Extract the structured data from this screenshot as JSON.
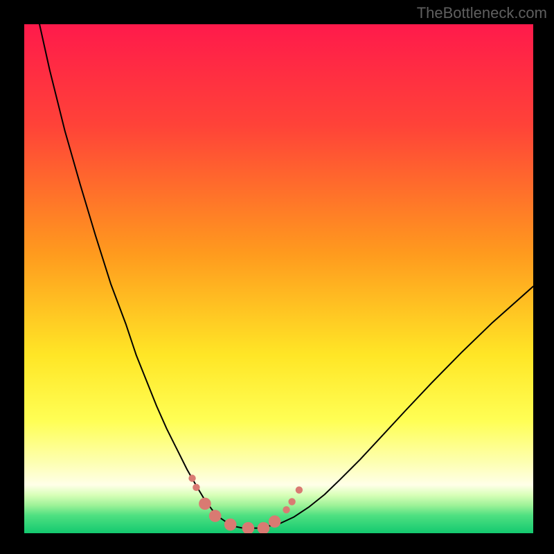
{
  "watermark": {
    "text": "TheBottleneck.com"
  },
  "chart_data": {
    "type": "line",
    "title": "",
    "xlabel": "",
    "ylabel": "",
    "xlim": [
      0,
      100
    ],
    "ylim": [
      0,
      100
    ],
    "grid": false,
    "background_gradient": {
      "stops": [
        {
          "offset": 0.0,
          "color": "#ff1a4b"
        },
        {
          "offset": 0.2,
          "color": "#ff4338"
        },
        {
          "offset": 0.45,
          "color": "#ff9a1e"
        },
        {
          "offset": 0.65,
          "color": "#ffe626"
        },
        {
          "offset": 0.78,
          "color": "#ffff55"
        },
        {
          "offset": 0.86,
          "color": "#fdffb0"
        },
        {
          "offset": 0.905,
          "color": "#ffffe8"
        },
        {
          "offset": 0.925,
          "color": "#d8ffb8"
        },
        {
          "offset": 0.945,
          "color": "#9ef298"
        },
        {
          "offset": 0.965,
          "color": "#4fe081"
        },
        {
          "offset": 1.0,
          "color": "#13c96f"
        }
      ]
    },
    "series": [
      {
        "name": "bottleneck-curve",
        "stroke": "#000000",
        "strokeWidth": 2,
        "x": [
          3,
          5,
          8,
          11,
          14,
          17,
          20,
          22,
          24,
          26,
          28,
          30,
          32,
          34,
          35.5,
          37,
          38.5,
          40,
          41.5,
          43,
          46,
          50,
          53,
          56,
          59,
          62,
          66,
          70,
          75,
          80,
          86,
          92,
          100
        ],
        "y": [
          100,
          91,
          79,
          68.5,
          58.5,
          49,
          41,
          35,
          30,
          25,
          20.5,
          16.5,
          12.5,
          9,
          6.5,
          4.5,
          3,
          2,
          1.3,
          1,
          1,
          1.8,
          3.2,
          5.2,
          7.6,
          10.5,
          14.5,
          18.8,
          24.2,
          29.5,
          35.6,
          41.4,
          48.5
        ]
      }
    ],
    "markers": {
      "color": "#d97a72",
      "r_small": 5.2,
      "r_large": 8.8,
      "points": [
        {
          "x": 33.0,
          "y": 10.8,
          "size": "small"
        },
        {
          "x": 33.8,
          "y": 9.0,
          "size": "small"
        },
        {
          "x": 35.5,
          "y": 5.8,
          "size": "large"
        },
        {
          "x": 37.5,
          "y": 3.4,
          "size": "large"
        },
        {
          "x": 40.5,
          "y": 1.7,
          "size": "large"
        },
        {
          "x": 44.0,
          "y": 1.0,
          "size": "large"
        },
        {
          "x": 47.0,
          "y": 1.0,
          "size": "large"
        },
        {
          "x": 49.2,
          "y": 2.3,
          "size": "large"
        },
        {
          "x": 51.5,
          "y": 4.6,
          "size": "small"
        },
        {
          "x": 52.6,
          "y": 6.2,
          "size": "small"
        },
        {
          "x": 54.0,
          "y": 8.5,
          "size": "small"
        }
      ]
    }
  }
}
